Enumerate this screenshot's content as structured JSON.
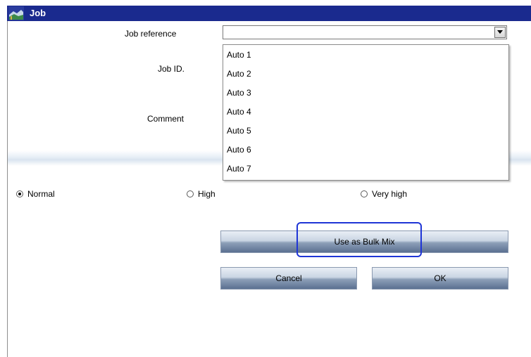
{
  "window": {
    "title": "Job",
    "icon": "app-icon"
  },
  "form": {
    "job_reference_label": "Job reference",
    "job_reference_value": "",
    "job_id_label": "Job ID.",
    "comment_label": "Comment"
  },
  "dropdown": {
    "options": [
      "Auto 1",
      "Auto 2",
      "Auto 3",
      "Auto 4",
      "Auto 5",
      "Auto 6",
      "Auto 7"
    ]
  },
  "priority": {
    "options": [
      {
        "label": "Normal",
        "checked": true
      },
      {
        "label": "High",
        "checked": false
      },
      {
        "label": "Very high",
        "checked": false
      }
    ]
  },
  "buttons": {
    "bulk_mix": "Use as Bulk Mix",
    "cancel": "Cancel",
    "ok": "OK"
  },
  "colors": {
    "titlebar": "#1a2a8e",
    "highlight": "#1f35d6"
  }
}
